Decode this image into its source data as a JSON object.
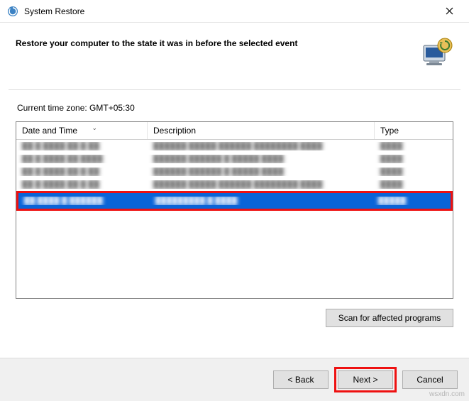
{
  "window": {
    "title": "System Restore",
    "close_label": "✕"
  },
  "header": {
    "heading": "Restore your computer to the state it was in before the selected event"
  },
  "content": {
    "timezone_label": "Current time zone: GMT+05:30",
    "columns": {
      "date": "Date and Time",
      "desc": "Description",
      "type": "Type"
    },
    "rows": [
      {
        "date": "██ █ ████ ██ █ ██",
        "desc": "██████ █████ ██████ ████████ ████",
        "type": "████"
      },
      {
        "date": "██ █ ████ ██ ████",
        "desc": "██████ ██████ █ █████ ████",
        "type": "████"
      },
      {
        "date": "██ █ ████ ██ █ ██",
        "desc": "██████ ██████ █ █████ ████",
        "type": "████"
      },
      {
        "date": "██ █ ████ ██ █ ██",
        "desc": "██████ █████ ██████ ████████ ████",
        "type": "████"
      }
    ],
    "selected_row": {
      "date": "██ ████ █ ██████",
      "desc": "█████████ █ ████",
      "type": "█████"
    },
    "scan_button": "Scan for affected programs"
  },
  "footer": {
    "back": "< Back",
    "next": "Next >",
    "cancel": "Cancel"
  },
  "watermark": "wsxdn.com"
}
